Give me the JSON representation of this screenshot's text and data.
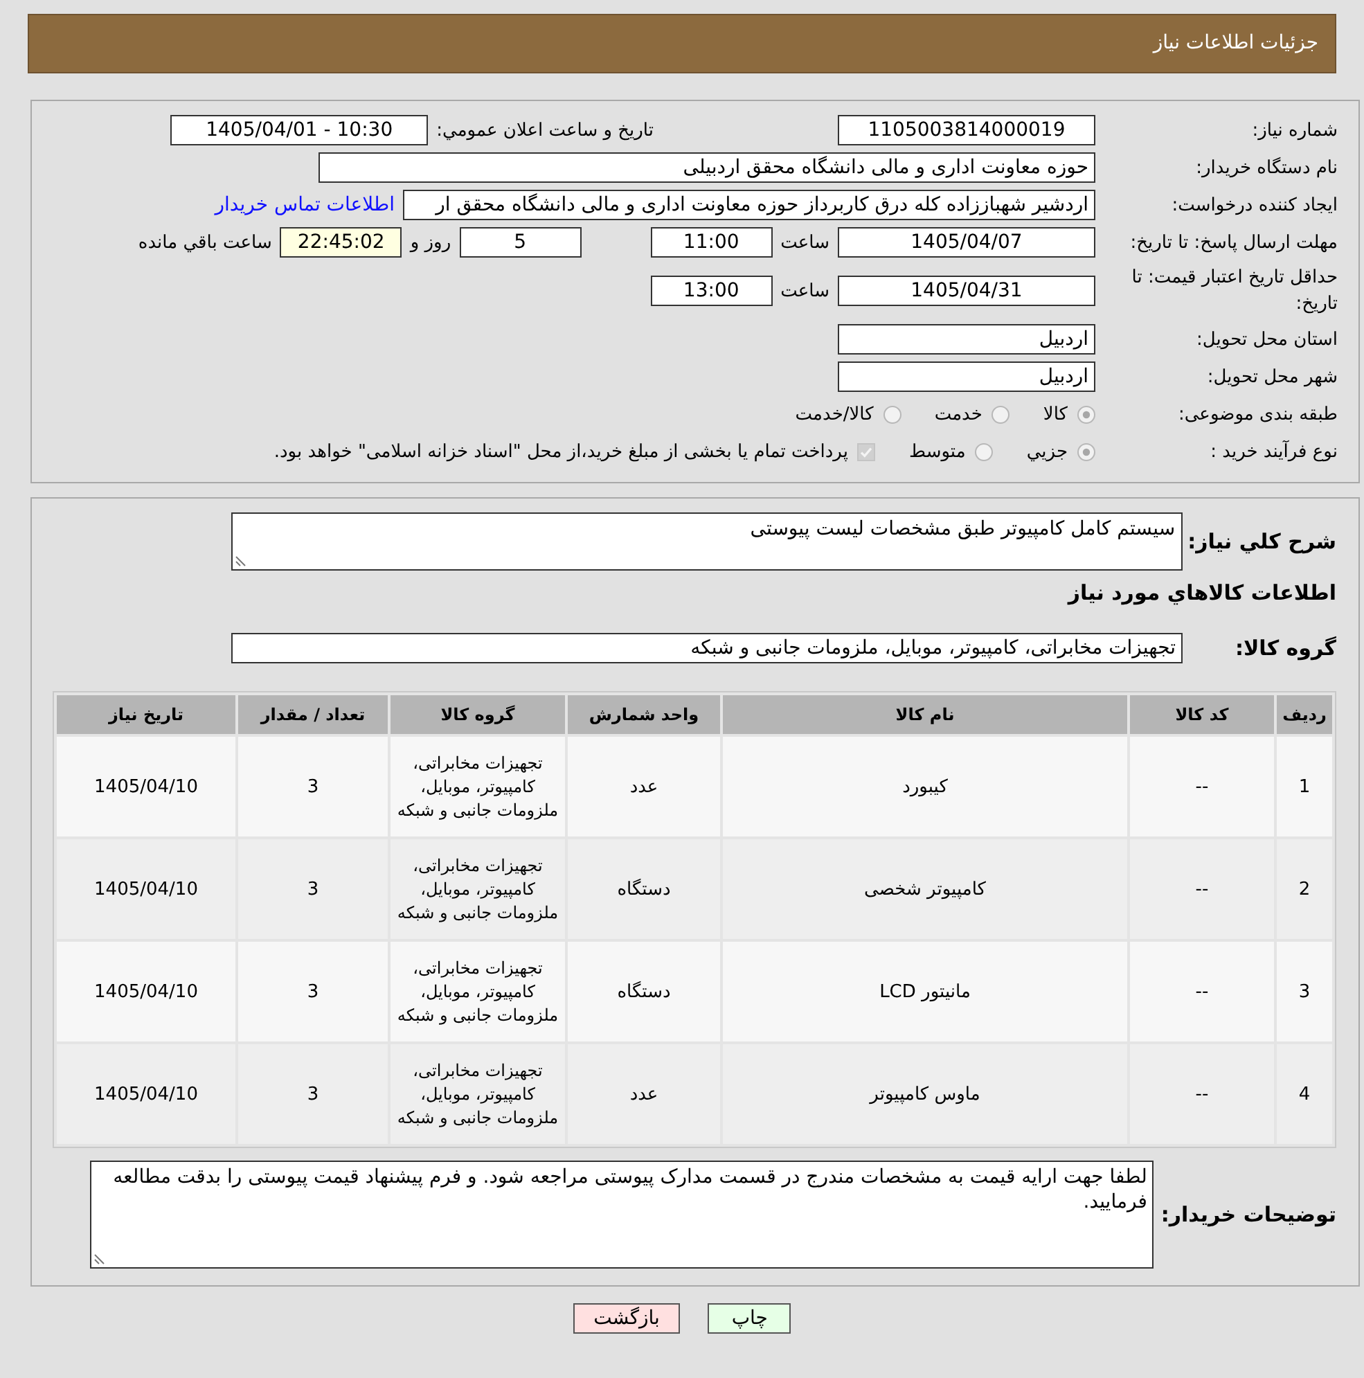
{
  "title": "جزئیات اطلاعات نیاز",
  "details": {
    "need_number": {
      "label": "شماره نیاز:",
      "value": "1105003814000019"
    },
    "announcement": {
      "label": "تاریخ و ساعت اعلان عمومي:",
      "value": "1405/04/01 - 10:30"
    },
    "buyer_org": {
      "label": "نام دستگاه خریدار:",
      "value": "حوزه معاونت اداری و مالی دانشگاه محقق اردبیلی"
    },
    "requester": {
      "label": "ایجاد کننده درخواست:",
      "value": "اردشیر شهباززاده کله درق کاربرداز حوزه معاونت اداری و مالی دانشگاه محقق ار",
      "link": "اطلاعات تماس خریدار"
    },
    "response_deadline": {
      "label": "مهلت ارسال پاسخ: تا تاریخ:",
      "date": "1405/04/07",
      "time_label": "ساعت",
      "time": "11:00",
      "days": "5",
      "days_label": "روز و",
      "remaining": "22:45:02",
      "remaining_label": "ساعت باقي مانده"
    },
    "price_validity": {
      "label": "حداقل تاریخ اعتبار قیمت: تا تاریخ:",
      "date": "1405/04/31",
      "time_label": "ساعت",
      "time": "13:00"
    },
    "delivery_province": {
      "label": "استان محل تحویل:",
      "value": "اردبیل"
    },
    "delivery_city": {
      "label": "شهر محل تحویل:",
      "value": "اردبیل"
    },
    "subject_category": {
      "label": "طبقه بندی موضوعی:",
      "disabled": true,
      "options": [
        {
          "label": "کالا",
          "selected": true
        },
        {
          "label": "خدمت",
          "selected": false
        },
        {
          "label": "کالا/خدمت",
          "selected": false
        }
      ]
    },
    "process_type": {
      "label": "نوع فرآیند خرید :",
      "disabled": true,
      "options": [
        {
          "label": "جزيي",
          "selected": true
        },
        {
          "label": "متوسط",
          "selected": false
        }
      ],
      "treasury": {
        "label": "پرداخت تمام یا بخشی از مبلغ خرید،از محل \"اسناد خزانه اسلامی\" خواهد بود.",
        "checked": true,
        "disabled": true
      }
    }
  },
  "goods": {
    "description": {
      "label": "شرح کلي نیاز:",
      "value": "سیستم کامل کامپیوتر طبق مشخصات لیست پیوستی"
    },
    "heading": "اطلاعات کالاهاي مورد نیاز",
    "group": {
      "label": "گروه کالا:",
      "value": "تجهیزات مخابراتی، کامپیوتر، موبایل، ملزومات جانبی و شبکه"
    },
    "table": {
      "columns": [
        "ردیف",
        "کد کالا",
        "نام کالا",
        "واحد شمارش",
        "گروه کالا",
        "تعداد / مقدار",
        "تاریخ نیاز"
      ],
      "rows": [
        [
          "1",
          "--",
          "کیبورد",
          "عدد",
          "تجهیزات مخابراتی، کامپیوتر، موبایل، ملزومات جانبی و شبکه",
          "3",
          "1405/04/10"
        ],
        [
          "2",
          "--",
          "کامپیوتر شخصی",
          "دستگاه",
          "تجهیزات مخابراتی، کامپیوتر، موبایل، ملزومات جانبی و شبکه",
          "3",
          "1405/04/10"
        ],
        [
          "3",
          "--",
          "مانیتور LCD",
          "دستگاه",
          "تجهیزات مخابراتی، کامپیوتر، موبایل، ملزومات جانبی و شبکه",
          "3",
          "1405/04/10"
        ],
        [
          "4",
          "--",
          "ماوس کامپیوتر",
          "عدد",
          "تجهیزات مخابراتی، کامپیوتر، موبایل، ملزومات جانبی و شبکه",
          "3",
          "1405/04/10"
        ]
      ]
    },
    "buyer_notes": {
      "label": "توضیحات خریدار:",
      "value": "لطفا جهت ارایه قیمت به مشخصات مندرج در قسمت مدارک پیوستی مراجعه شود. و فرم پیشنهاد قیمت پیوستی را بدقت مطالعه فرمایید."
    }
  },
  "buttons": [
    {
      "kind": "print",
      "label": "چاپ"
    },
    {
      "kind": "back",
      "label": "بازگشت"
    }
  ]
}
